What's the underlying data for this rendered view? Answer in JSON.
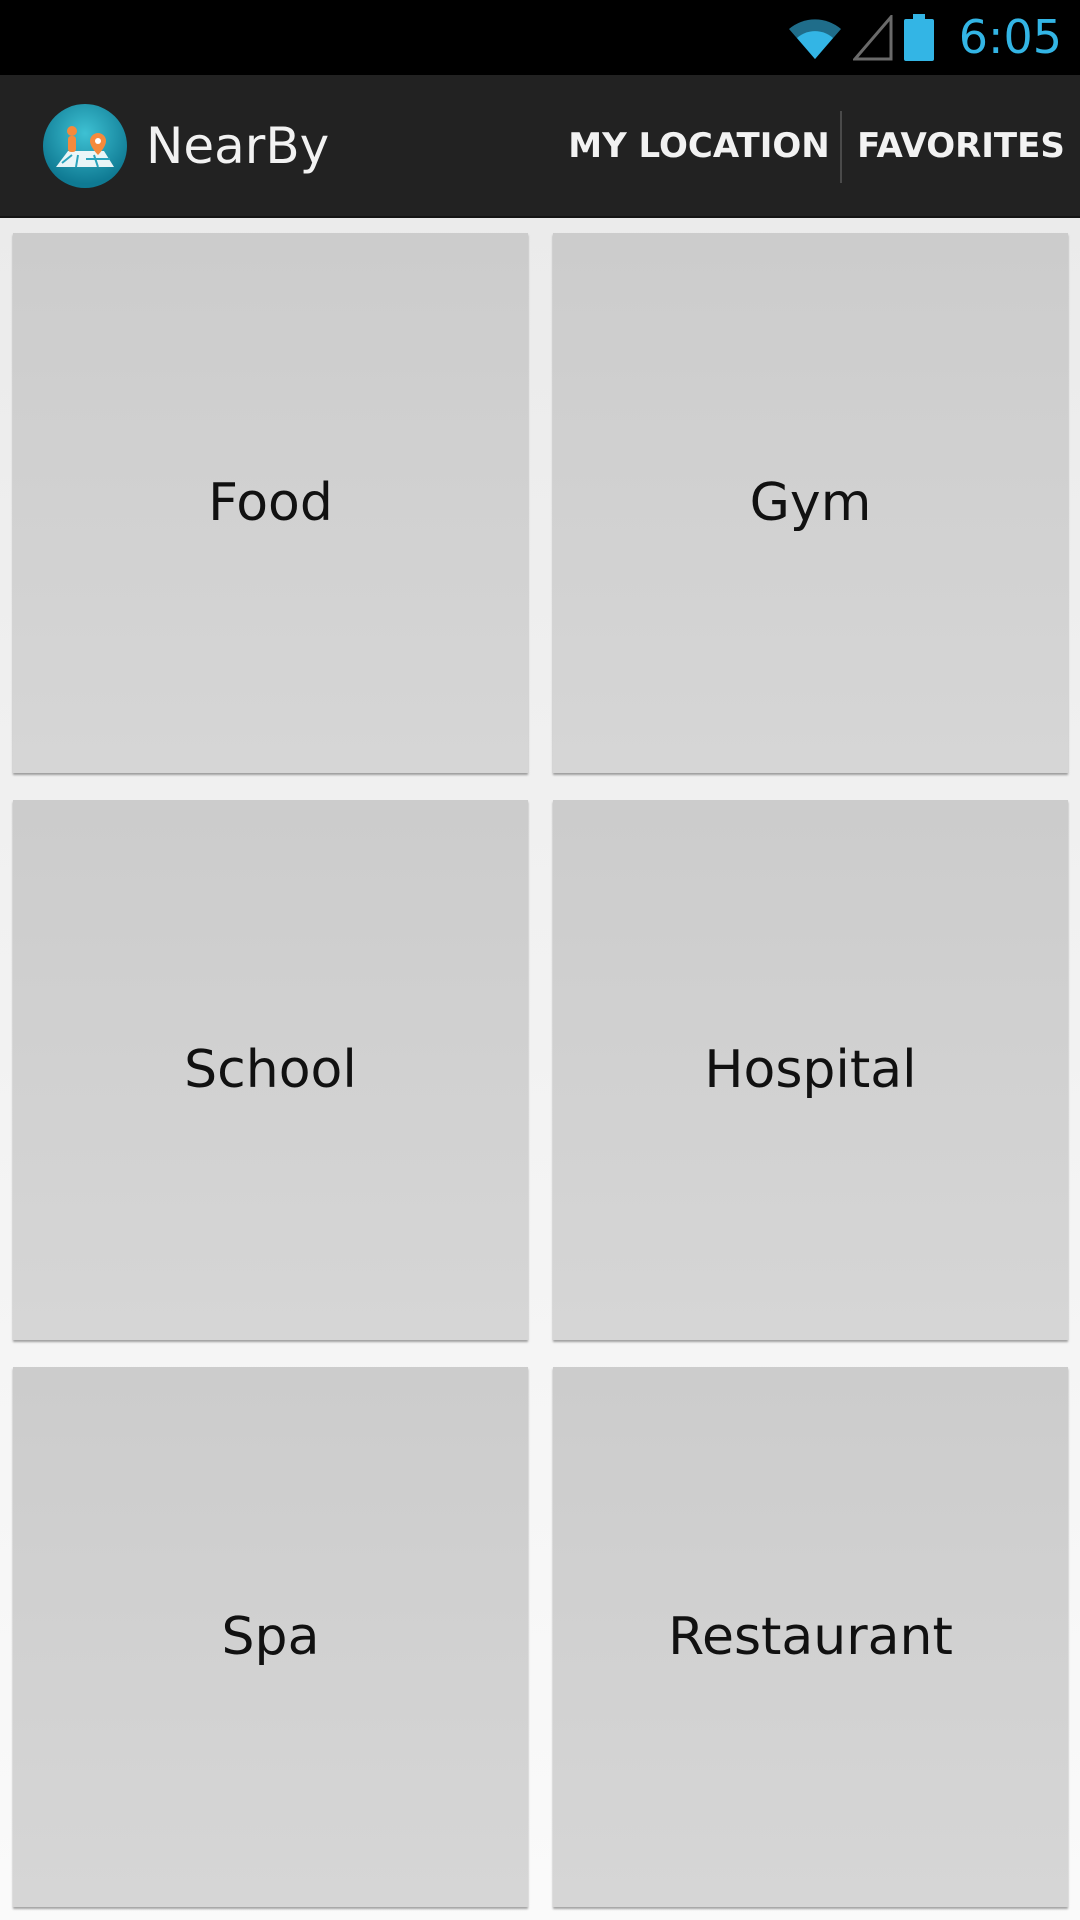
{
  "status_bar": {
    "time": "6:05",
    "icons": [
      "wifi-icon",
      "cell-signal-icon",
      "battery-icon"
    ],
    "accent_color": "#33b5e5"
  },
  "action_bar": {
    "app_title": "NearBy",
    "logo_icon": "nearby-map-logo-icon",
    "actions": [
      {
        "label": "MY LOCATION"
      },
      {
        "label": "FAVORITES"
      }
    ]
  },
  "categories": [
    {
      "label": "Food"
    },
    {
      "label": "Gym"
    },
    {
      "label": "School"
    },
    {
      "label": "Hospital"
    },
    {
      "label": "Spa"
    },
    {
      "label": "Restaurant"
    }
  ]
}
